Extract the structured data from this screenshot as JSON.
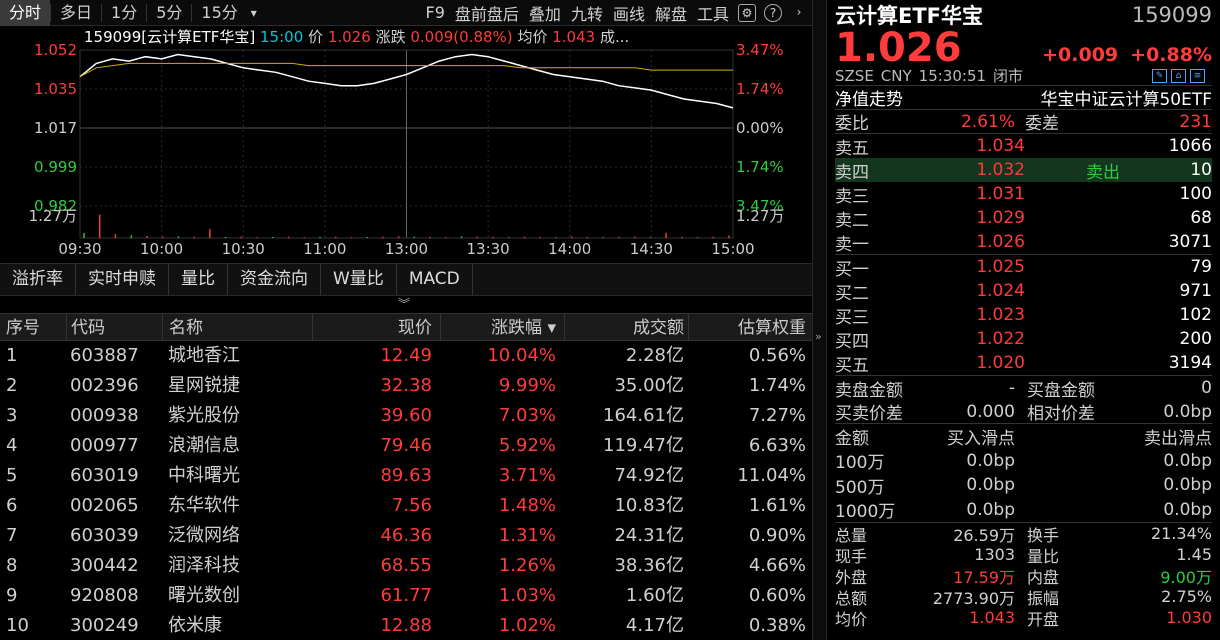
{
  "toolbar": {
    "timeframes": [
      "分时",
      "多日",
      "1分",
      "5分",
      "15分"
    ],
    "dropdown": "▾",
    "tools": [
      "F9",
      "盘前盘后",
      "叠加",
      "九转",
      "画线",
      "解盘",
      "工具"
    ]
  },
  "chart_info": {
    "code_name": "159099[云计算ETF华宝]",
    "time": "15:00",
    "price_label": "价",
    "price": "1.026",
    "change_label": "涨跌",
    "change": "0.009(0.88%)",
    "avg_label": "均价",
    "avg": "1.043",
    "vol_label": "成..."
  },
  "chart_axes": {
    "left": [
      "1.052",
      "1.035",
      "1.017",
      "0.999",
      "0.982",
      "1.27万"
    ],
    "right": [
      "3.47%",
      "1.74%",
      "0.00%",
      "1.74%",
      "3.47%",
      "1.27万"
    ],
    "times": [
      "09:30",
      "10:00",
      "10:30",
      "11:00",
      "13:00",
      "13:30",
      "14:00",
      "14:30",
      "15:00"
    ]
  },
  "chart_data": {
    "type": "line",
    "ylim": [
      0.982,
      1.052
    ],
    "prev_close": 1.017,
    "time_ticks": [
      "09:30",
      "10:00",
      "10:30",
      "11:00",
      "13:00",
      "13:30",
      "14:00",
      "14:30",
      "15:00"
    ],
    "series": [
      {
        "values": [
          1.04,
          1.046,
          1.048,
          1.047,
          1.049,
          1.048,
          1.05,
          1.049,
          1.048,
          1.046,
          1.044,
          1.043,
          1.042,
          1.04,
          1.038,
          1.037,
          1.036,
          1.036,
          1.037,
          1.039,
          1.041,
          1.044,
          1.047,
          1.049,
          1.05,
          1.049,
          1.047,
          1.045,
          1.043,
          1.041,
          1.04,
          1.039,
          1.038,
          1.036,
          1.035,
          1.034,
          1.032,
          1.03,
          1.029,
          1.028,
          1.026
        ]
      },
      {
        "values": [
          1.04,
          1.044,
          1.045,
          1.046,
          1.046,
          1.046,
          1.046,
          1.046,
          1.046,
          1.046,
          1.046,
          1.046,
          1.046,
          1.046,
          1.045,
          1.045,
          1.045,
          1.045,
          1.045,
          1.045,
          1.045,
          1.045,
          1.045,
          1.045,
          1.045,
          1.045,
          1.045,
          1.044,
          1.044,
          1.044,
          1.044,
          1.044,
          1.044,
          1.044,
          1.044,
          1.043,
          1.043,
          1.043,
          1.043,
          1.043,
          1.043
        ]
      }
    ],
    "volume_max": "1.27万",
    "volume": [
      0.2,
      0.9,
      0.15,
      0.1,
      0.08,
      0.05,
      0.06,
      0.05,
      0.35,
      0.04,
      0.05,
      0.03,
      0.04,
      0.05,
      0.03,
      0.04,
      0.05,
      0.03,
      0.04,
      0.05,
      0.06,
      0.05,
      0.04,
      0.03,
      0.06,
      0.05,
      0.04,
      0.03,
      0.05,
      0.04,
      0.03,
      0.05,
      0.04,
      0.03,
      0.04,
      0.05,
      0.03,
      0.2,
      0.04,
      0.03,
      0.05,
      0.1
    ]
  },
  "bottom_tabs": [
    "溢折率",
    "实时申赎",
    "量比",
    "资金流向",
    "W量比",
    "MACD"
  ],
  "table": {
    "headers": [
      "序号",
      "代码",
      "名称",
      "现价",
      "涨跌幅 ▾",
      "成交额",
      "估算权重"
    ],
    "rows": [
      [
        "1",
        "603887",
        "城地香江",
        "12.49",
        "10.04%",
        "2.28亿",
        "0.56%"
      ],
      [
        "2",
        "002396",
        "星网锐捷",
        "32.38",
        "9.99%",
        "35.00亿",
        "1.74%"
      ],
      [
        "3",
        "000938",
        "紫光股份",
        "39.60",
        "7.03%",
        "164.61亿",
        "7.27%"
      ],
      [
        "4",
        "000977",
        "浪潮信息",
        "79.46",
        "5.92%",
        "119.47亿",
        "6.63%"
      ],
      [
        "5",
        "603019",
        "中科曙光",
        "89.63",
        "3.71%",
        "74.92亿",
        "11.04%"
      ],
      [
        "6",
        "002065",
        "东华软件",
        "7.56",
        "1.48%",
        "10.83亿",
        "1.61%"
      ],
      [
        "7",
        "603039",
        "泛微网络",
        "46.36",
        "1.31%",
        "24.31亿",
        "0.90%"
      ],
      [
        "8",
        "300442",
        "润泽科技",
        "68.55",
        "1.26%",
        "38.36亿",
        "4.66%"
      ],
      [
        "9",
        "920808",
        "曙光数创",
        "61.77",
        "1.03%",
        "1.60亿",
        "0.60%"
      ],
      [
        "10",
        "300249",
        "依米康",
        "12.88",
        "1.02%",
        "4.17亿",
        "0.38%"
      ]
    ]
  },
  "quote": {
    "name": "云计算ETF华宝",
    "code": "159099",
    "price": "1.026",
    "change": "+0.009",
    "change_pct": "+0.88%",
    "exchange": "SZSE",
    "currency": "CNY",
    "time": "15:30:51",
    "status": "闭市",
    "nav_label": "净值走势",
    "index_name": "华宝中证云计算50ETF",
    "weibi_label": "委比",
    "weibi": "2.61%",
    "weicha_label": "委差",
    "weicha": "231",
    "asks": [
      {
        "label": "卖五",
        "price": "1.034",
        "vol": "1066"
      },
      {
        "label": "卖四",
        "price": "1.032",
        "vol": "10",
        "tag": "卖出"
      },
      {
        "label": "卖三",
        "price": "1.031",
        "vol": "100"
      },
      {
        "label": "卖二",
        "price": "1.029",
        "vol": "68"
      },
      {
        "label": "卖一",
        "price": "1.026",
        "vol": "3071"
      }
    ],
    "bids": [
      {
        "label": "买一",
        "price": "1.025",
        "vol": "79"
      },
      {
        "label": "买二",
        "price": "1.024",
        "vol": "971"
      },
      {
        "label": "买三",
        "price": "1.023",
        "vol": "102"
      },
      {
        "label": "买四",
        "price": "1.022",
        "vol": "200"
      },
      {
        "label": "买五",
        "price": "1.020",
        "vol": "3194"
      }
    ],
    "sell_amt_label": "卖盘金额",
    "sell_amt": "-",
    "buy_amt_label": "买盘金额",
    "buy_amt": "0",
    "spread_label": "买卖价差",
    "spread": "0.000",
    "rel_spread_label": "相对价差",
    "rel_spread": "0.0bp",
    "slip_headers": [
      "金额",
      "买入滑点",
      "卖出滑点"
    ],
    "slips": [
      [
        "100万",
        "0.0bp",
        "0.0bp"
      ],
      [
        "500万",
        "0.0bp",
        "0.0bp"
      ],
      [
        "1000万",
        "0.0bp",
        "0.0bp"
      ]
    ],
    "stats": [
      [
        "总量",
        "26.59万",
        "换手",
        "21.34%"
      ],
      [
        "现手",
        "1303",
        "量比",
        "1.45"
      ],
      [
        "外盘",
        "17.59万",
        "内盘",
        "9.00万"
      ],
      [
        "总额",
        "2773.90万",
        "振幅",
        "2.75%"
      ],
      [
        "均价",
        "1.043",
        "开盘",
        "1.030"
      ]
    ]
  }
}
